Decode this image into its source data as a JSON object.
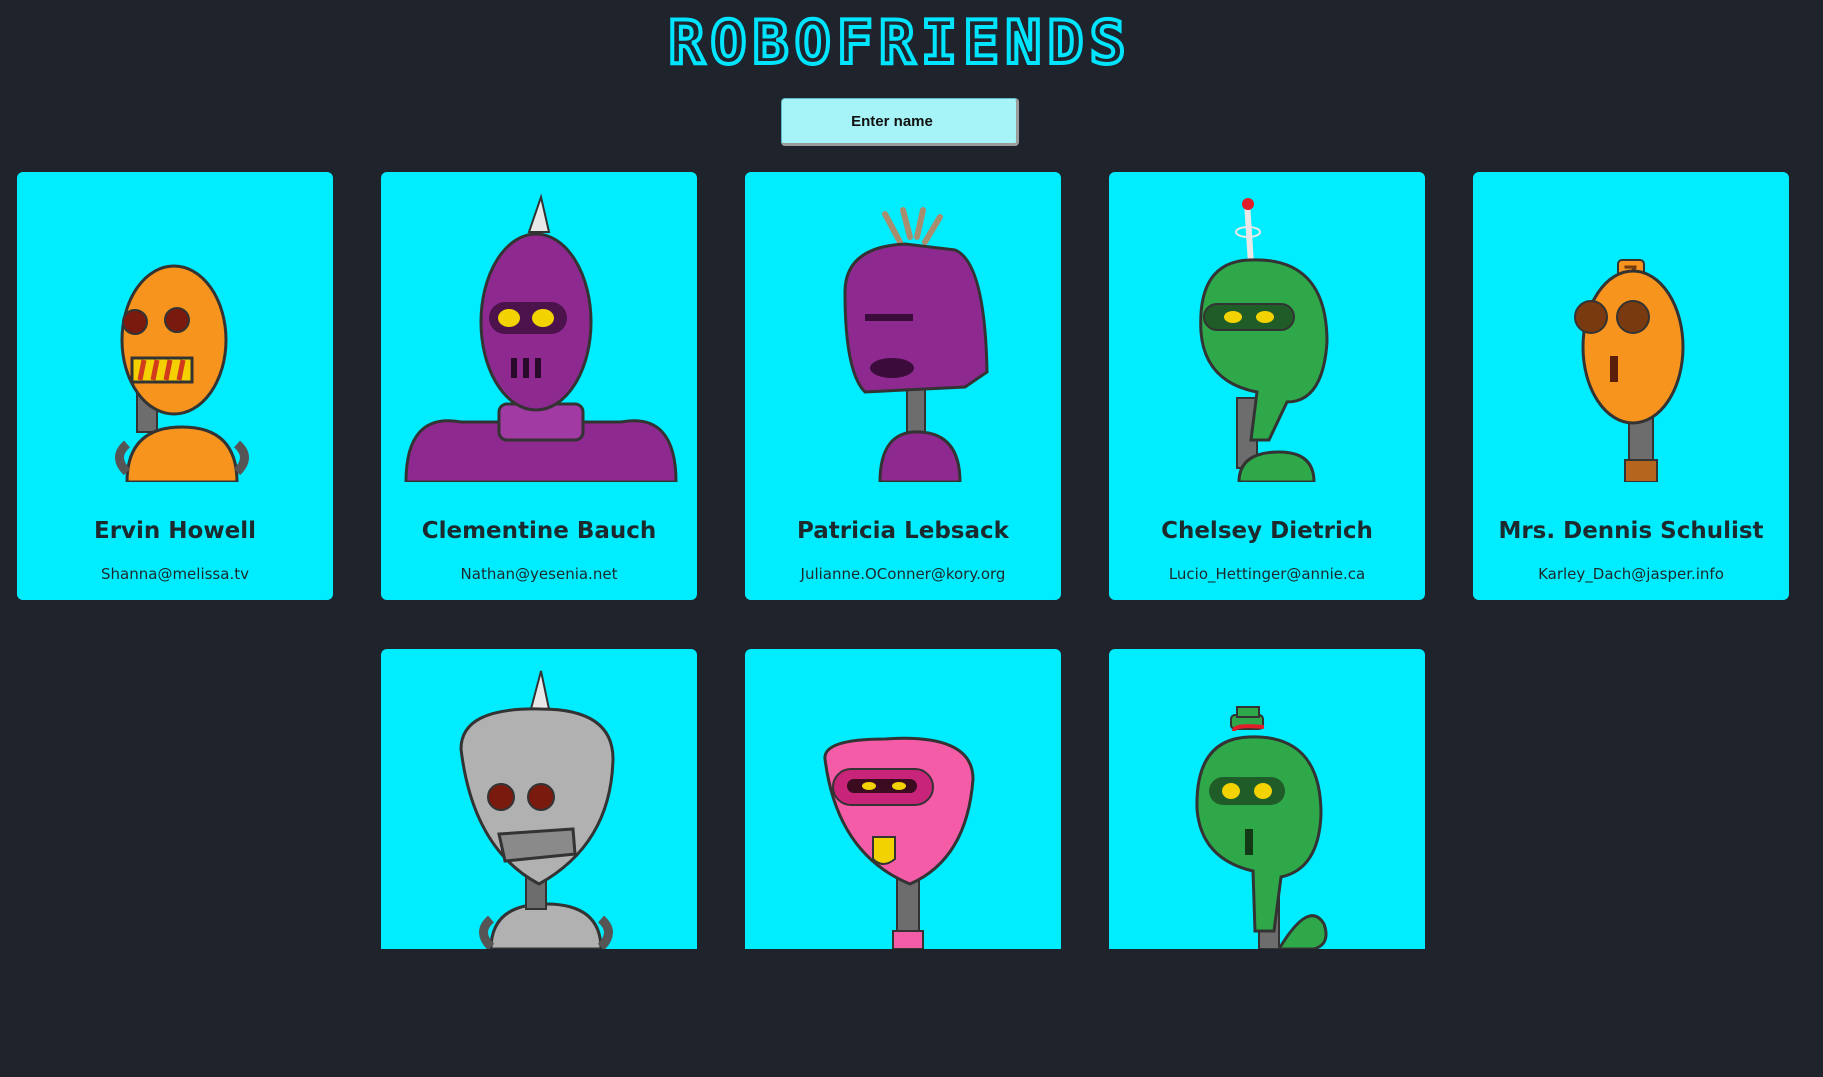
{
  "app": {
    "title": "ROBOFRIENDS"
  },
  "search": {
    "placeholder": "Enter name",
    "value": ""
  },
  "robots": [
    {
      "name": "Ervin Howell",
      "email": "Shanna@melissa.tv",
      "color": "#f7941d",
      "icon": "orange-robot-icon"
    },
    {
      "name": "Clementine Bauch",
      "email": "Nathan@yesenia.net",
      "color": "#8e2a8f",
      "icon": "purple-robot-icon"
    },
    {
      "name": "Patricia Lebsack",
      "email": "Julianne.OConner@kory.org",
      "color": "#8e2a8f",
      "icon": "purple-robot-icon"
    },
    {
      "name": "Chelsey Dietrich",
      "email": "Lucio_Hettinger@annie.ca",
      "color": "#2fa84a",
      "icon": "green-robot-icon"
    },
    {
      "name": "Mrs. Dennis Schulist",
      "email": "Karley_Dach@jasper.info",
      "color": "#f7941d",
      "icon": "orange-robot-icon"
    },
    {
      "name": "",
      "email": "",
      "color": "#b1b1b1",
      "icon": "grey-robot-icon"
    },
    {
      "name": "",
      "email": "",
      "color": "#f55ca8",
      "icon": "pink-robot-icon"
    },
    {
      "name": "",
      "email": "",
      "color": "#2fa84a",
      "icon": "green-robot-icon"
    }
  ],
  "colors": {
    "background": "#1f232b",
    "card": "#00edff",
    "accent": "#00e5ff",
    "search": "#a7f4f8"
  }
}
